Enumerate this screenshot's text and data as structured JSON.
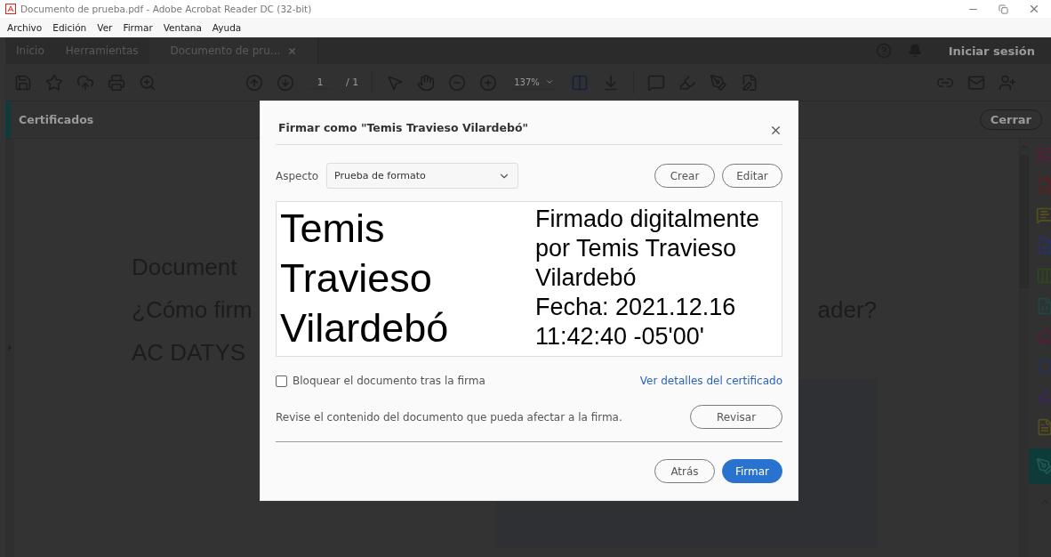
{
  "window": {
    "title": "Documento de prueba.pdf - Adobe Acrobat Reader DC (32-bit)"
  },
  "menu": [
    "Archivo",
    "Edición",
    "Ver",
    "Firmar",
    "Ventana",
    "Ayuda"
  ],
  "tabs": [
    {
      "label": "Inicio",
      "selected": false,
      "closable": false
    },
    {
      "label": "Herramientas",
      "selected": false,
      "closable": false
    },
    {
      "label": "Documento de pru...",
      "selected": true,
      "closable": true
    }
  ],
  "account": {
    "sign_in": "Iniciar sesión"
  },
  "toolbar": {
    "page_current": "1",
    "page_total": "/ 1",
    "zoom": "137%"
  },
  "panel": {
    "title": "Certificados",
    "close_button": "Cerrar"
  },
  "document": {
    "lines": [
      {
        "left": "Document"
      },
      {
        "left": "¿Cómo firm",
        "right": "ader?"
      },
      {
        "left": "AC DATYS"
      }
    ]
  },
  "dialog": {
    "title": "Firmar como \"Temis Travieso Vilardebó\"",
    "appearance_label": "Aspecto",
    "appearance_value": "Prueba de formato",
    "create_button": "Crear",
    "edit_button": "Editar",
    "preview": {
      "name_lines": [
        "Temis",
        "Travieso",
        "Vilardebó"
      ],
      "detail_lines": [
        "Firmado digitalmente",
        "por Temis Travieso",
        "Vilardebó",
        "Fecha: 2021.12.16",
        "11:42:40 -05'00'"
      ]
    },
    "lock": {
      "label": "Bloquear el documento tras la firma",
      "checked": false
    },
    "details_link": "Ver detalles del certificado",
    "review_text": "Revise el contenido del documento que pueda afectar a la firma.",
    "review_button": "Revisar",
    "back_button": "Atrás",
    "sign_button": "Firmar"
  }
}
